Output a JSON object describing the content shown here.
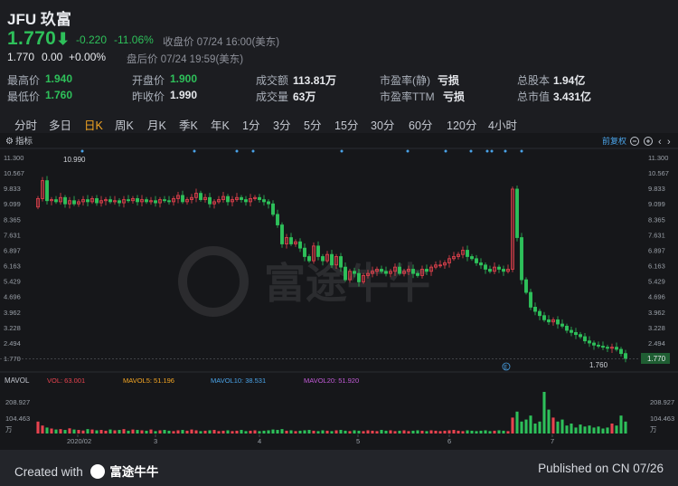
{
  "header": {
    "title": "JFU 玖富",
    "price": "1.770",
    "change": "-0.220",
    "change_pct": "-11.06%",
    "close_label": "收盘价 07/24 16:00(美东)",
    "after_price": "1.770",
    "after_change": "0.00",
    "after_pct": "+0.00%",
    "after_label": "盘后价 07/24 19:59(美东)"
  },
  "stats": {
    "high_label": "最高价",
    "high": "1.940",
    "low_label": "最低价",
    "low": "1.760",
    "open_label": "开盘价",
    "open": "1.900",
    "prev_label": "昨收价",
    "prev": "1.990",
    "amount_label": "成交额",
    "amount": "113.81万",
    "volume_label": "成交量",
    "volume": "63万",
    "pe_static_label": "市盈率(静)",
    "pe_static": "亏损",
    "pe_ttm_label": "市盈率TTM",
    "pe_ttm": "亏损",
    "shares_label": "总股本",
    "shares": "1.94亿",
    "mcap_label": "总市值",
    "mcap": "3.431亿"
  },
  "tabs": [
    "分时",
    "多日",
    "日K",
    "周K",
    "月K",
    "季K",
    "年K",
    "1分",
    "3分",
    "5分",
    "15分",
    "30分",
    "60分",
    "120分",
    "4小时"
  ],
  "active_tab": "日K",
  "chart_header": {
    "indicator": "指标",
    "adjust": "前复权"
  },
  "chart_data": {
    "type": "candlestick",
    "y_ticks": [
      "11.300",
      "10.567",
      "9.833",
      "9.099",
      "8.365",
      "7.631",
      "6.897",
      "6.163",
      "5.429",
      "4.696",
      "3.962",
      "3.228",
      "2.494",
      "1.770"
    ],
    "high_marker": "10.990",
    "low_marker": "1.760",
    "current_tag": "1.770",
    "ylim": [
      1.76,
      11.3
    ],
    "x_labels": [
      "2020/02",
      "3",
      "4",
      "5",
      "6",
      "7"
    ],
    "closes": [
      9.35,
      10.2,
      9.25,
      9.3,
      9.2,
      9.4,
      9.1,
      9.25,
      9.1,
      9.2,
      9.3,
      9.2,
      9.35,
      9.15,
      9.25,
      9.3,
      9.2,
      9.25,
      9.15,
      9.3,
      9.25,
      9.35,
      9.2,
      9.3,
      9.2,
      9.25,
      9.15,
      9.3,
      9.25,
      9.2,
      9.35,
      9.5,
      9.2,
      9.3,
      9.4,
      9.6,
      9.3,
      9.4,
      9.1,
      9.2,
      9.3,
      9.45,
      9.2,
      9.3,
      9.4,
      9.3,
      9.2,
      9.35,
      9.4,
      9.3,
      9.2,
      9.1,
      8.6,
      8.1,
      7.2,
      7.5,
      7.2,
      7.3,
      7.0,
      6.6,
      6.4,
      7.1,
      6.6,
      6.4,
      6.7,
      6.2,
      6.6,
      6.1,
      5.5,
      5.9,
      5.8,
      5.4,
      5.7,
      5.8,
      5.9,
      6.0,
      5.9,
      5.8,
      5.9,
      6.1,
      5.8,
      5.9,
      6.0,
      5.8,
      5.7,
      6.0,
      5.9,
      6.1,
      6.2,
      6.2,
      6.3,
      6.5,
      6.6,
      6.7,
      6.9,
      6.6,
      6.5,
      6.3,
      6.2,
      6.0,
      5.9,
      6.1,
      6.0,
      5.9,
      6.0,
      9.8,
      7.5,
      5.5,
      4.9,
      4.2,
      4.0,
      3.8,
      3.6,
      3.5,
      3.6,
      3.4,
      3.3,
      3.1,
      3.0,
      2.9,
      2.8,
      2.6,
      2.5,
      2.4,
      2.35,
      2.3,
      2.25,
      2.3,
      2.2,
      2.0,
      1.77
    ],
    "volumes": [
      60,
      40,
      30,
      25,
      20,
      22,
      18,
      26,
      20,
      18,
      15,
      22,
      20,
      16,
      18,
      14,
      20,
      16,
      18,
      22,
      14,
      20,
      18,
      16,
      14,
      20,
      12,
      16,
      18,
      14,
      12,
      16,
      18,
      14,
      20,
      16,
      12,
      14,
      16,
      18,
      12,
      14,
      16,
      12,
      14,
      18,
      12,
      14,
      16,
      12,
      14,
      16,
      20,
      18,
      22,
      14,
      16,
      12,
      14,
      16,
      18,
      14,
      12,
      16,
      14,
      12,
      16,
      18,
      14,
      12,
      16,
      14,
      12,
      16,
      14,
      12,
      18,
      14,
      16,
      12,
      14,
      16,
      12,
      14,
      16,
      14,
      12,
      16,
      14,
      12,
      14,
      16,
      18,
      14,
      12,
      16,
      14,
      12,
      14,
      16,
      12,
      14,
      16,
      14,
      12,
      80,
      110,
      60,
      70,
      90,
      50,
      60,
      209,
      120,
      80,
      60,
      70,
      40,
      50,
      30,
      45,
      35,
      40,
      30,
      35,
      25,
      30,
      50,
      40,
      90,
      60
    ],
    "vol_ticks": [
      "208.927",
      "104.463",
      "万"
    ],
    "mavol": {
      "label": "MAVOL",
      "vol": "VOL: 63.001",
      "ma5": "MAVOL5: 51.196",
      "ma10": "MAVOL10: 38.531",
      "ma20": "MAVOL20: 51.920"
    }
  },
  "watermark": "富途牛牛",
  "footer": {
    "created_prefix": "Created with",
    "brand": "富途牛牛",
    "published": "Published on CN 07/26"
  },
  "colors": {
    "up": "#e8434f",
    "down": "#2ec05a",
    "ma5": "#f5a623",
    "ma10": "#4aa3e8",
    "ma20": "#c35bd8",
    "accent": "#f5a623"
  }
}
